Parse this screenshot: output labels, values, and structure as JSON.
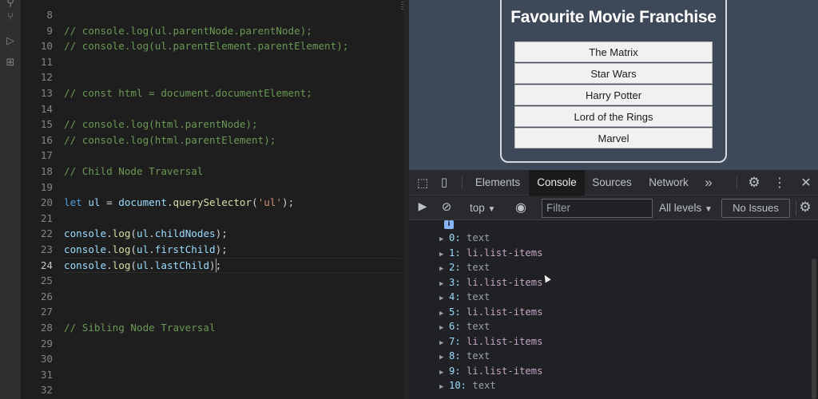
{
  "editor": {
    "lines": [
      {
        "num": "8",
        "tokens": []
      },
      {
        "num": "9",
        "tokens": [
          {
            "t": "comment",
            "v": "// console.log(ul.parentNode.parentNode);"
          }
        ]
      },
      {
        "num": "10",
        "tokens": [
          {
            "t": "comment",
            "v": "// console.log(ul.parentElement.parentElement);"
          }
        ]
      },
      {
        "num": "11",
        "tokens": []
      },
      {
        "num": "12",
        "tokens": []
      },
      {
        "num": "13",
        "tokens": [
          {
            "t": "comment",
            "v": "// const html = document.documentElement;"
          }
        ]
      },
      {
        "num": "14",
        "tokens": []
      },
      {
        "num": "15",
        "tokens": [
          {
            "t": "comment",
            "v": "// console.log(html.parentNode);"
          }
        ]
      },
      {
        "num": "16",
        "tokens": [
          {
            "t": "comment",
            "v": "// console.log(html.parentElement);"
          }
        ]
      },
      {
        "num": "17",
        "tokens": []
      },
      {
        "num": "18",
        "tokens": [
          {
            "t": "comment",
            "v": "// Child Node Traversal"
          }
        ]
      },
      {
        "num": "19",
        "tokens": []
      },
      {
        "num": "20",
        "tokens": [
          {
            "t": "keyword",
            "v": "let"
          },
          {
            "t": "plain",
            "v": " "
          },
          {
            "t": "var",
            "v": "ul"
          },
          {
            "t": "plain",
            "v": " = "
          },
          {
            "t": "var",
            "v": "document"
          },
          {
            "t": "plain",
            "v": "."
          },
          {
            "t": "fn",
            "v": "querySelector"
          },
          {
            "t": "plain",
            "v": "("
          },
          {
            "t": "str",
            "v": "'ul'"
          },
          {
            "t": "plain",
            "v": ");"
          }
        ]
      },
      {
        "num": "21",
        "tokens": []
      },
      {
        "num": "22",
        "tokens": [
          {
            "t": "var",
            "v": "console"
          },
          {
            "t": "plain",
            "v": "."
          },
          {
            "t": "fn",
            "v": "log"
          },
          {
            "t": "plain",
            "v": "("
          },
          {
            "t": "var",
            "v": "ul"
          },
          {
            "t": "plain",
            "v": "."
          },
          {
            "t": "var",
            "v": "childNodes"
          },
          {
            "t": "plain",
            "v": ");"
          }
        ]
      },
      {
        "num": "23",
        "tokens": [
          {
            "t": "var",
            "v": "console"
          },
          {
            "t": "plain",
            "v": "."
          },
          {
            "t": "fn",
            "v": "log"
          },
          {
            "t": "plain",
            "v": "("
          },
          {
            "t": "var",
            "v": "ul"
          },
          {
            "t": "plain",
            "v": "."
          },
          {
            "t": "var",
            "v": "firstChild"
          },
          {
            "t": "plain",
            "v": ");"
          }
        ]
      },
      {
        "num": "24",
        "active": true,
        "tokens": [
          {
            "t": "var",
            "v": "console"
          },
          {
            "t": "plain",
            "v": "."
          },
          {
            "t": "fn",
            "v": "log"
          },
          {
            "t": "plain",
            "v": "("
          },
          {
            "t": "var",
            "v": "ul"
          },
          {
            "t": "plain",
            "v": "."
          },
          {
            "t": "var",
            "v": "lastChild"
          },
          {
            "t": "plain",
            "v": ");"
          }
        ]
      },
      {
        "num": "25",
        "tokens": []
      },
      {
        "num": "26",
        "tokens": []
      },
      {
        "num": "27",
        "tokens": []
      },
      {
        "num": "28",
        "tokens": [
          {
            "t": "comment",
            "v": "// Sibling Node Traversal"
          }
        ]
      },
      {
        "num": "29",
        "tokens": []
      },
      {
        "num": "30",
        "tokens": []
      },
      {
        "num": "31",
        "tokens": []
      },
      {
        "num": "32",
        "tokens": []
      }
    ]
  },
  "preview": {
    "title": "Favourite Movie Franchise",
    "movies": [
      "The Matrix",
      "Star Wars",
      "Harry Potter",
      "Lord of the Rings",
      "Marvel"
    ]
  },
  "devtools": {
    "tabs": [
      {
        "label": "Elements",
        "active": false
      },
      {
        "label": "Console",
        "active": true
      },
      {
        "label": "Sources",
        "active": false
      },
      {
        "label": "Network",
        "active": false
      }
    ],
    "more_tabs_icon": "»",
    "context": "top",
    "filter_placeholder": "Filter",
    "levels_label": "All levels",
    "issues_label": "No Issues",
    "info_badge": "i",
    "console_rows": [
      {
        "key": "0:",
        "value": "text"
      },
      {
        "key": "1:",
        "value": "li.list-items"
      },
      {
        "key": "2:",
        "value": "text"
      },
      {
        "key": "3:",
        "value": "li.list-items"
      },
      {
        "key": "4:",
        "value": "text"
      },
      {
        "key": "5:",
        "value": "li.list-items"
      },
      {
        "key": "6:",
        "value": "text"
      },
      {
        "key": "7:",
        "value": "li.list-items"
      },
      {
        "key": "8:",
        "value": "text"
      },
      {
        "key": "9:",
        "value": "li.list-items"
      },
      {
        "key": "10:",
        "value": "text"
      }
    ]
  },
  "colors": {
    "comment": "#6a9955",
    "keyword": "#569cd6",
    "variable": "#9cdcfe",
    "function": "#dcdcaa",
    "string": "#ce9178",
    "preview_bg": "#3e4a5a"
  }
}
